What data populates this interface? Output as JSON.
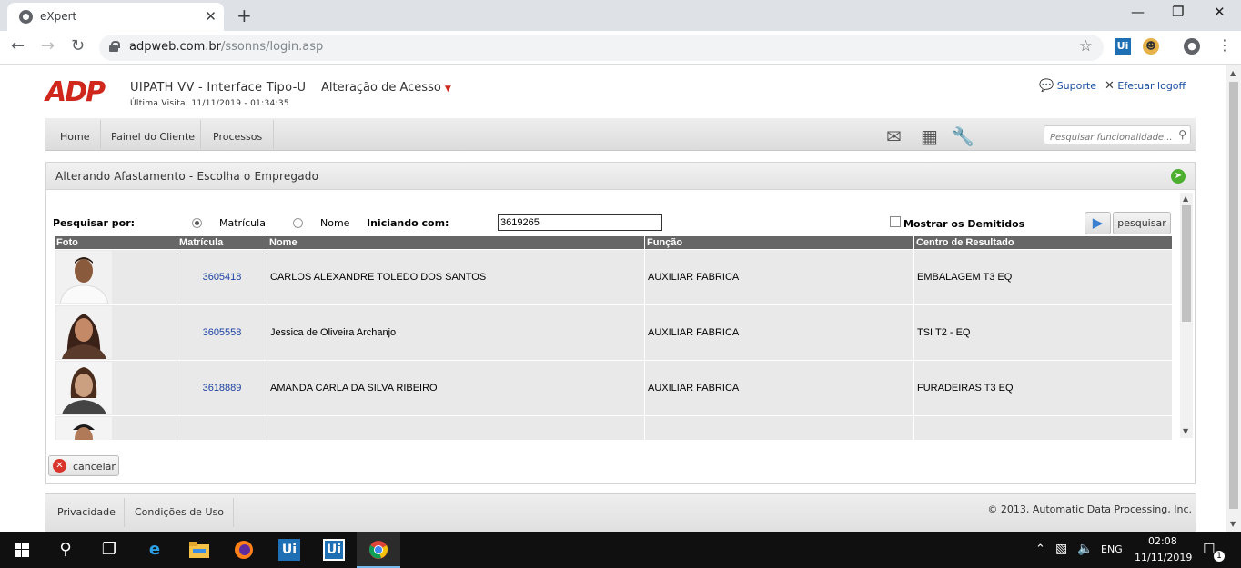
{
  "browser": {
    "tab_title": "eXpert",
    "tab_close": "✕",
    "new_tab": "+",
    "url_host": "adpweb.com.br",
    "url_path": "/ssonns/login.asp",
    "extension_ui": "Ui"
  },
  "header": {
    "logo": "ADP",
    "app_title": "UIPATH VV - Interface Tipo-U",
    "last_visit": "Última Visita: 11/11/2019 - 01:34:35",
    "access_label": "Alteração de Acesso",
    "support_label": "Suporte",
    "logoff_label": "Efetuar logoff"
  },
  "nav": {
    "items": [
      "Home",
      "Painel do Cliente",
      "Processos"
    ],
    "search_placeholder": "Pesquisar funcionalidade..."
  },
  "panel": {
    "title": "Alterando Afastamento - Escolha o Empregado"
  },
  "search_form": {
    "search_by_label": "Pesquisar por:",
    "option_matricula": "Matrícula",
    "option_nome": "Nome",
    "selected_option": "Matrícula",
    "starting_with_label": "Iniciando com:",
    "starting_with_value": "3619265",
    "show_dismissed_label": "Mostrar os Demitidos",
    "show_dismissed_checked": false,
    "search_button": "pesquisar"
  },
  "table": {
    "columns": [
      "Foto",
      "Matrícula",
      "Nome",
      "Função",
      "Centro de Resultado"
    ],
    "rows": [
      {
        "matricula": "3605418",
        "nome": "CARLOS ALEXANDRE TOLEDO DOS SANTOS",
        "funcao": "AUXILIAR FABRICA",
        "centro": "EMBALAGEM T3 EQ"
      },
      {
        "matricula": "3605558",
        "nome": "Jessica de Oliveira Archanjo",
        "funcao": "AUXILIAR FABRICA",
        "centro": "TSI T2 - EQ"
      },
      {
        "matricula": "3618889",
        "nome": "AMANDA CARLA DA SILVA RIBEIRO",
        "funcao": "AUXILIAR FABRICA",
        "centro": "FURADEIRAS T3 EQ"
      }
    ]
  },
  "actions": {
    "cancel_label": "cancelar"
  },
  "footer": {
    "privacy": "Privacidade",
    "terms": "Condições de Uso",
    "copyright": "© 2013, Automatic Data Processing, Inc."
  },
  "taskbar": {
    "lang": "ENG",
    "time": "02:08",
    "date": "11/11/2019",
    "uipath_label": "Ui",
    "notifications": "1"
  },
  "colors": {
    "adp_red": "#d0271d",
    "link_blue": "#1a3fa0",
    "table_header": "#666666"
  }
}
